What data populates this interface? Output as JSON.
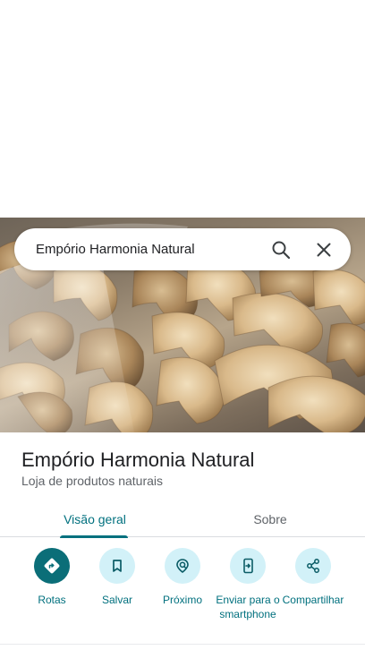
{
  "search": {
    "query": "Empório Harmonia Natural"
  },
  "place": {
    "name": "Empório Harmonia Natural",
    "category": "Loja de produtos naturais"
  },
  "tabs": [
    {
      "label": "Visão geral",
      "active": true
    },
    {
      "label": "Sobre",
      "active": false
    }
  ],
  "actions": [
    {
      "label": "Rotas",
      "icon": "directions-icon"
    },
    {
      "label": "Salvar",
      "icon": "bookmark-icon"
    },
    {
      "label": "Próximo",
      "icon": "nearby-icon"
    },
    {
      "label": "Enviar para o smartphone",
      "icon": "send-to-phone-icon"
    },
    {
      "label": "Compartilhar",
      "icon": "share-icon"
    }
  ],
  "colors": {
    "accent": "#00707e",
    "primary_action": "#0b6e78",
    "action_circle": "#d2f1f8"
  }
}
